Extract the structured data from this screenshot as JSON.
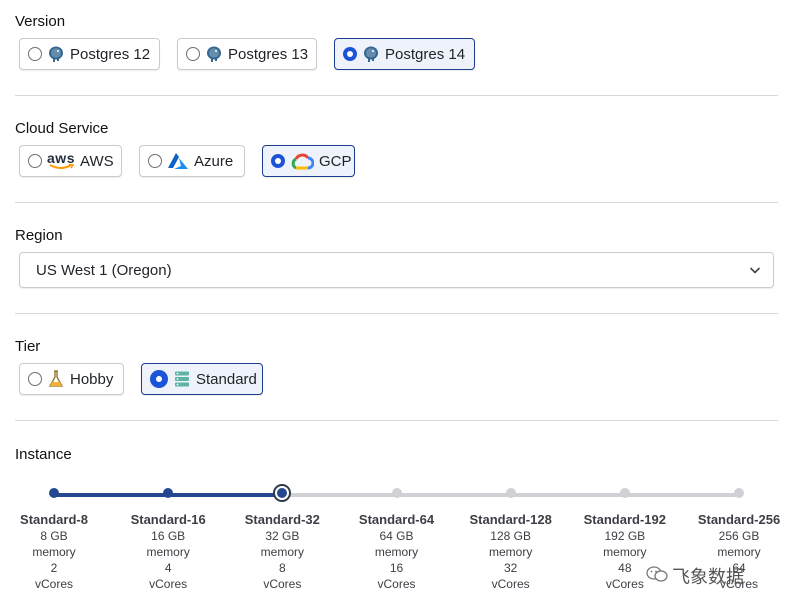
{
  "version": {
    "label": "Version",
    "options": [
      {
        "label": "Postgres 12",
        "selected": false,
        "icon": "postgres-elephant-icon"
      },
      {
        "label": "Postgres 13",
        "selected": false,
        "icon": "postgres-elephant-icon"
      },
      {
        "label": "Postgres 14",
        "selected": true,
        "icon": "postgres-elephant-icon"
      }
    ]
  },
  "cloud": {
    "label": "Cloud Service",
    "options": [
      {
        "label": "AWS",
        "selected": false,
        "icon": "aws-logo-icon",
        "logo_text": "aws"
      },
      {
        "label": "Azure",
        "selected": false,
        "icon": "azure-logo-icon"
      },
      {
        "label": "GCP",
        "selected": true,
        "icon": "gcp-cloud-icon"
      }
    ]
  },
  "region": {
    "label": "Region",
    "value": "US West 1 (Oregon)"
  },
  "tier": {
    "label": "Tier",
    "options": [
      {
        "label": "Hobby",
        "selected": false,
        "icon": "flask-icon"
      },
      {
        "label": "Standard",
        "selected": true,
        "icon": "server-stack-icon"
      }
    ]
  },
  "instance": {
    "label": "Instance",
    "selected_index": 2,
    "steps": [
      {
        "name": "Standard-8",
        "memory": "8 GB",
        "memory_label": "memory",
        "vcores": "2",
        "vcores_label": "vCores"
      },
      {
        "name": "Standard-16",
        "memory": "16 GB",
        "memory_label": "memory",
        "vcores": "4",
        "vcores_label": "vCores"
      },
      {
        "name": "Standard-32",
        "memory": "32 GB",
        "memory_label": "memory",
        "vcores": "8",
        "vcores_label": "vCores"
      },
      {
        "name": "Standard-64",
        "memory": "64 GB",
        "memory_label": "memory",
        "vcores": "16",
        "vcores_label": "vCores"
      },
      {
        "name": "Standard-128",
        "memory": "128 GB",
        "memory_label": "memory",
        "vcores": "32",
        "vcores_label": "vCores"
      },
      {
        "name": "Standard-192",
        "memory": "192 GB",
        "memory_label": "memory",
        "vcores": "48",
        "vcores_label": "vCores"
      },
      {
        "name": "Standard-256",
        "memory": "256 GB",
        "memory_label": "memory",
        "vcores": "64",
        "vcores_label": "vCores"
      }
    ]
  },
  "watermark": {
    "text": "飞象数据",
    "icon": "wechat-icon"
  },
  "colors": {
    "accent": "#1b54d6",
    "slider_fill": "#24478f",
    "slider_track": "#cfd1d4"
  }
}
